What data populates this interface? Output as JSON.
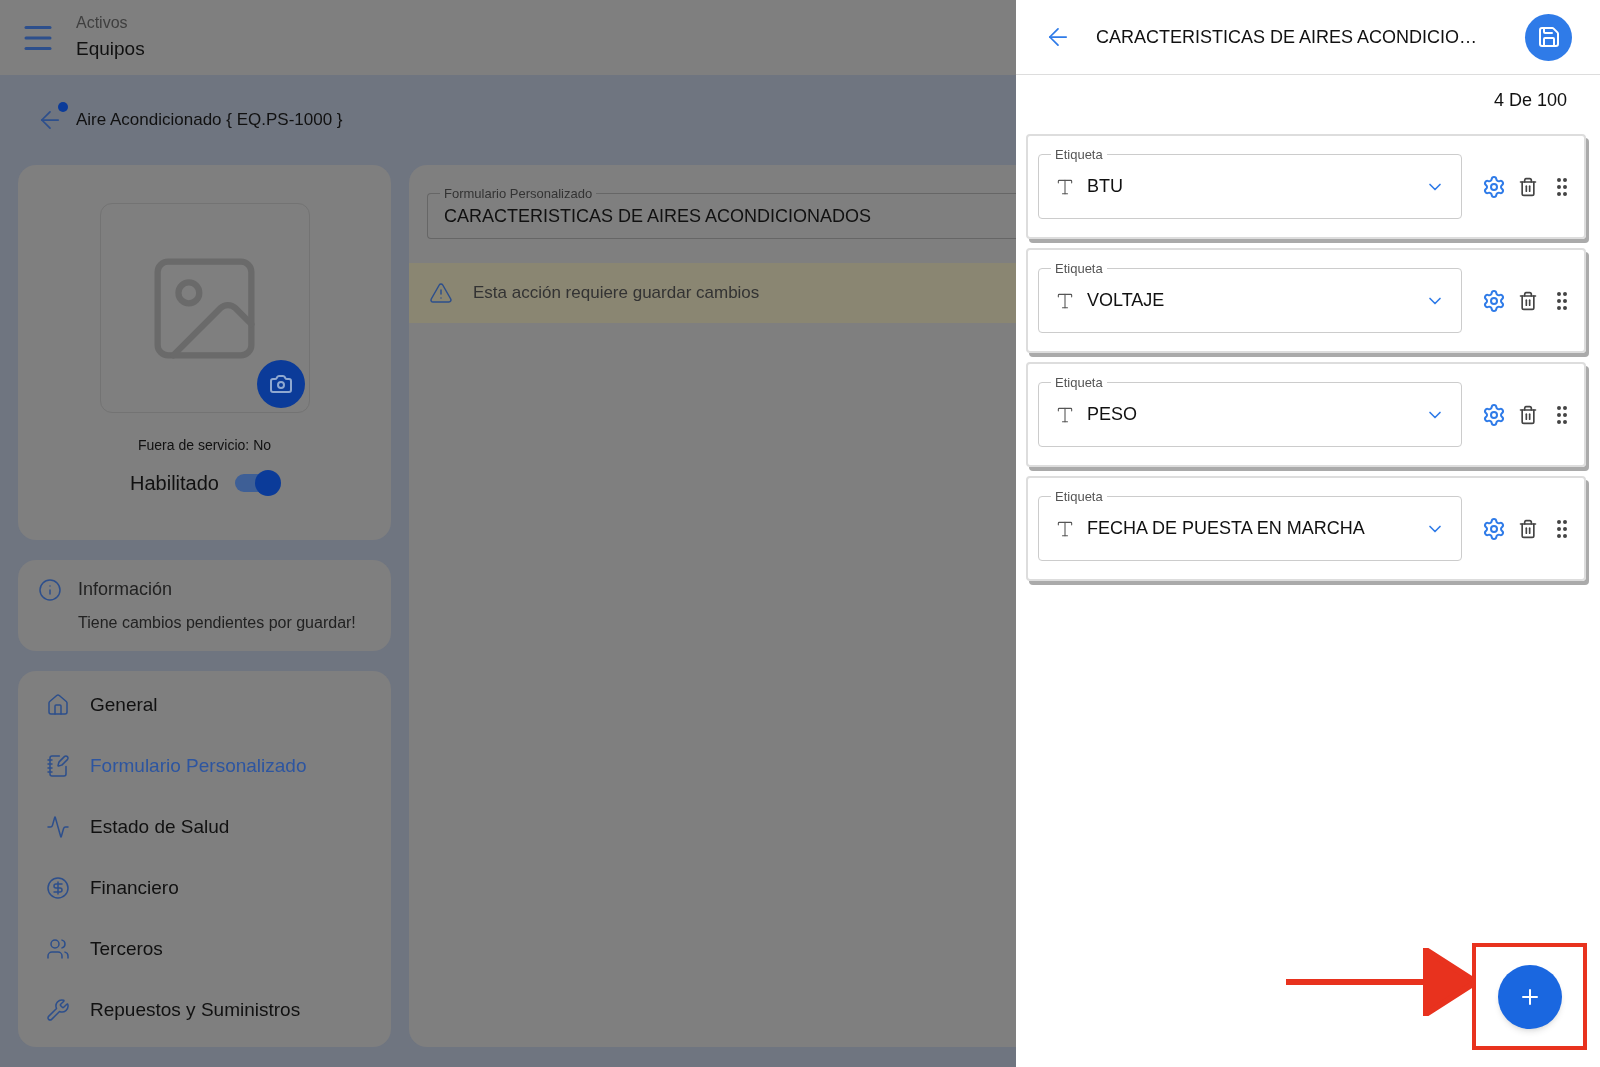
{
  "header": {
    "section": "Activos",
    "title": "Equipos"
  },
  "breadcrumb": {
    "title": "Aire Acondicionado { EQ.PS-1000 }",
    "unsaved": true
  },
  "equipment": {
    "out_of_service": "Fuera de servicio: No",
    "enabled_label": "Habilitado",
    "enabled": true
  },
  "info": {
    "title": "Información",
    "message": "Tiene cambios pendientes por guardar!"
  },
  "nav": [
    {
      "label": "General",
      "selected": false
    },
    {
      "label": "Formulario Personalizado",
      "selected": true
    },
    {
      "label": "Estado de Salud",
      "selected": false
    },
    {
      "label": "Financiero",
      "selected": false
    },
    {
      "label": "Terceros",
      "selected": false
    },
    {
      "label": "Repuestos y Suministros",
      "selected": false
    }
  ],
  "form": {
    "label": "Formulario Personalizado",
    "value": "CARACTERISTICAS DE AIRES ACONDICIONADOS",
    "warning": "Esta acción requiere guardar cambios"
  },
  "panel": {
    "title": "CARACTERISTICAS DE AIRES ACONDICIO…",
    "count": "4 De 100",
    "fields": [
      {
        "label": "Etiqueta",
        "value": "BTU"
      },
      {
        "label": "Etiqueta",
        "value": "VOLTAJE"
      },
      {
        "label": "Etiqueta",
        "value": "PESO"
      },
      {
        "label": "Etiqueta",
        "value": "FECHA DE PUESTA EN MARCHA"
      }
    ]
  }
}
